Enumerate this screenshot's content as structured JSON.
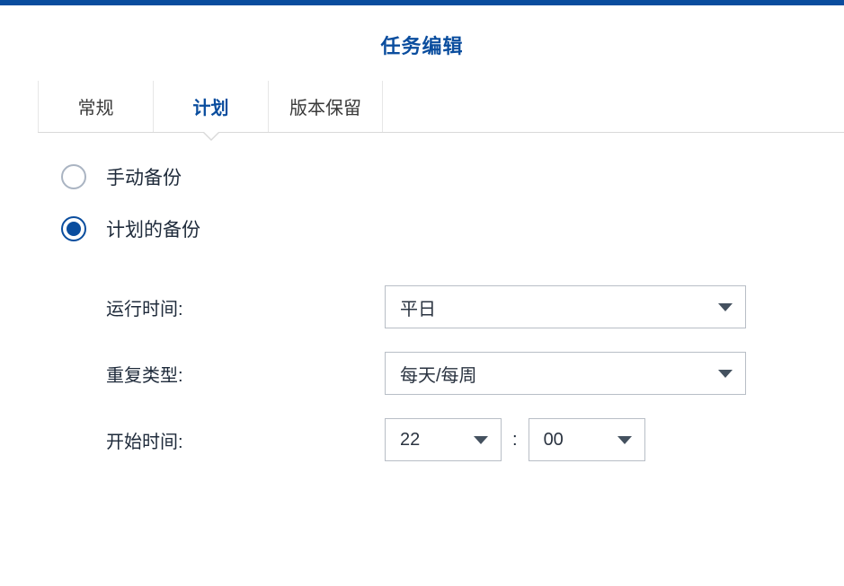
{
  "title": "任务编辑",
  "tabs": {
    "general": "常规",
    "schedule": "计划",
    "retention": "版本保留"
  },
  "radio": {
    "manual": "手动备份",
    "scheduled": "计划的备份"
  },
  "fields": {
    "run_time_label": "运行时间:",
    "run_time_value": "平日",
    "repeat_label": "重复类型:",
    "repeat_value": "每天/每周",
    "start_label": "开始时间:",
    "start_hour": "22",
    "start_minute": "00",
    "colon": ":"
  }
}
